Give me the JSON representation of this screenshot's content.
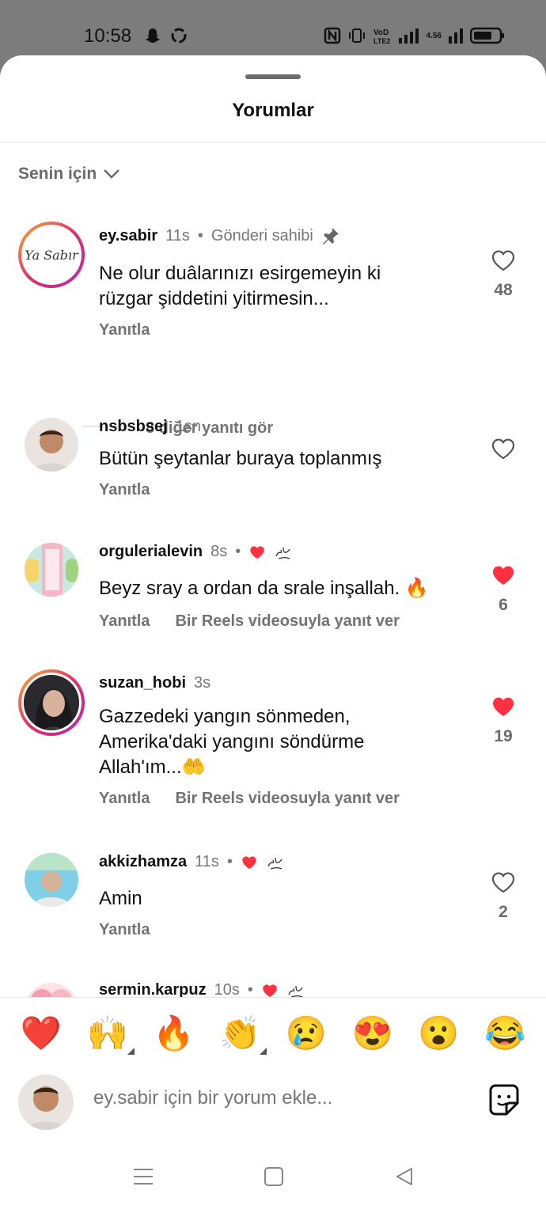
{
  "status": {
    "time": "10:58",
    "network": "4.56"
  },
  "sheet": {
    "title": "Yorumlar",
    "sort_label": "Senin için"
  },
  "comments": [
    {
      "username": "ey.sabir",
      "time": "11s",
      "owner_label": "Gönderi sahibi",
      "text": "Ne olur duâlarınızı esirgemeyin ki rüzgar şiddetini yitirmesin...",
      "reply": "Yanıtla",
      "likes": "48",
      "liked": false,
      "avatar_text": "Ya Sabır",
      "more_replies": "8 diğer yanıtı gör"
    },
    {
      "username": "nsbsbsej",
      "time": "1sn",
      "text": "Bütün şeytanlar buraya toplanmış",
      "reply": "Yanıtla",
      "likes": "",
      "liked": false
    },
    {
      "username": "orgulerialevin",
      "time": "8s",
      "text": "Beyz sray a ordan da srale inşallah. 🔥",
      "reply": "Yanıtla",
      "reels_reply": "Bir Reels videosuyla yanıt ver",
      "likes": "6",
      "liked": true
    },
    {
      "username": "suzan_hobi",
      "time": "3s",
      "text": "Gazzedeki yangın sönmeden, Amerika'daki yangını söndürme Allah'ım...🤲",
      "reply": "Yanıtla",
      "reels_reply": "Bir Reels videosuyla yanıt ver",
      "likes": "19",
      "liked": true
    },
    {
      "username": "akkizhamza",
      "time": "11s",
      "text": "Amin",
      "reply": "Yanıtla",
      "likes": "2",
      "liked": false
    },
    {
      "username": "sermin.karpuz",
      "time": "10s"
    }
  ],
  "emojis": [
    "❤️",
    "🙌",
    "🔥",
    "👏",
    "😢",
    "😍",
    "😮",
    "😂"
  ],
  "composer": {
    "placeholder": "ey.sabir için bir yorum ekle..."
  },
  "colors": {
    "heart_red": "#ff3040",
    "muted": "#737373"
  }
}
